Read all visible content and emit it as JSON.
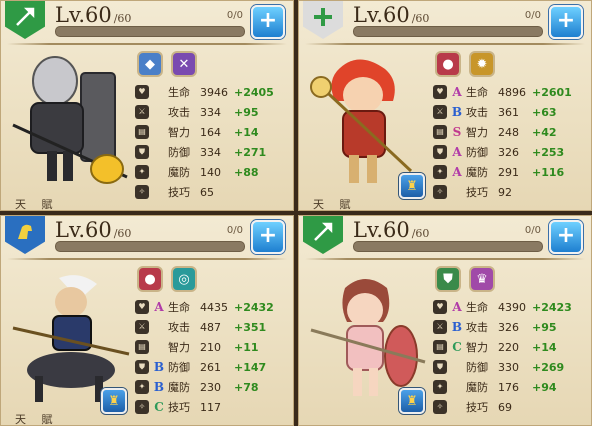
{
  "cards": [
    {
      "level_label": "Lv.60",
      "level_max": "/60",
      "exp_text": "0/0",
      "exp_fraction": 0,
      "class_icon": "spear-icon",
      "class_color": "#2f9a45",
      "plus_label": "+",
      "skills": [
        {
          "icon": "crystal-icon",
          "color": "#4a7fc8"
        },
        {
          "icon": "crossed-weapons-icon",
          "color": "#7a4ab0"
        }
      ],
      "talent_label": "",
      "stats": [
        {
          "icon": "heart-icon",
          "grade": "",
          "name": "生命",
          "value": "3946",
          "bonus": "+2405"
        },
        {
          "icon": "sword-icon",
          "grade": "",
          "name": "攻击",
          "value": "334",
          "bonus": "+95"
        },
        {
          "icon": "book-icon",
          "grade": "",
          "name": "智力",
          "value": "164",
          "bonus": "+14"
        },
        {
          "icon": "shield-icon",
          "grade": "",
          "name": "防御",
          "value": "334",
          "bonus": "+271"
        },
        {
          "icon": "magic-shield-icon",
          "grade": "",
          "name": "魔防",
          "value": "140",
          "bonus": "+88"
        },
        {
          "icon": "skill-icon",
          "grade": "",
          "name": "技巧",
          "value": "65",
          "bonus": ""
        }
      ]
    },
    {
      "level_label": "Lv.60",
      "level_max": "/60",
      "exp_text": "0/0",
      "exp_fraction": 0,
      "class_icon": "holy-cross-icon",
      "class_color": "#d8d8d8",
      "plus_label": "+",
      "skills": [
        {
          "icon": "bell-icon",
          "color": "#b83a4a"
        },
        {
          "icon": "sun-icon",
          "color": "#c8962a"
        }
      ],
      "talent_label": "天 賦",
      "stats": [
        {
          "icon": "heart-icon",
          "grade": "A",
          "name": "生命",
          "value": "4896",
          "bonus": "+2601"
        },
        {
          "icon": "sword-icon",
          "grade": "B",
          "name": "攻击",
          "value": "361",
          "bonus": "+63"
        },
        {
          "icon": "book-icon",
          "grade": "S",
          "name": "智力",
          "value": "248",
          "bonus": "+42"
        },
        {
          "icon": "shield-icon",
          "grade": "A",
          "name": "防御",
          "value": "326",
          "bonus": "+253"
        },
        {
          "icon": "magic-shield-icon",
          "grade": "A",
          "name": "魔防",
          "value": "291",
          "bonus": "+116"
        },
        {
          "icon": "skill-icon",
          "grade": "",
          "name": "技巧",
          "value": "92",
          "bonus": ""
        }
      ]
    },
    {
      "level_label": "Lv.60",
      "level_max": "/60",
      "exp_text": "0/0",
      "exp_fraction": 0,
      "class_icon": "horse-icon",
      "class_color": "#e0c040",
      "plus_label": "+",
      "skills": [
        {
          "icon": "bell-icon",
          "color": "#b83a4a"
        },
        {
          "icon": "swirl-icon",
          "color": "#2a9a9a"
        }
      ],
      "talent_label": "天 賦",
      "stats": [
        {
          "icon": "heart-icon",
          "grade": "A",
          "name": "生命",
          "value": "4435",
          "bonus": "+2432"
        },
        {
          "icon": "sword-icon",
          "grade": "",
          "name": "攻击",
          "value": "487",
          "bonus": "+351"
        },
        {
          "icon": "book-icon",
          "grade": "",
          "name": "智力",
          "value": "210",
          "bonus": "+11"
        },
        {
          "icon": "shield-icon",
          "grade": "B",
          "name": "防御",
          "value": "261",
          "bonus": "+147"
        },
        {
          "icon": "magic-shield-icon",
          "grade": "B",
          "name": "魔防",
          "value": "230",
          "bonus": "+78"
        },
        {
          "icon": "skill-icon",
          "grade": "C",
          "name": "技巧",
          "value": "117",
          "bonus": ""
        }
      ]
    },
    {
      "level_label": "Lv.60",
      "level_max": "/60",
      "exp_text": "0/0",
      "exp_fraction": 0,
      "class_icon": "spear-icon",
      "class_color": "#2f9a45",
      "plus_label": "+",
      "skills": [
        {
          "icon": "shield-emblem-icon",
          "color": "#3a8a4a"
        },
        {
          "icon": "crown-icon",
          "color": "#a04aa8"
        }
      ],
      "talent_label": "",
      "stats": [
        {
          "icon": "heart-icon",
          "grade": "A",
          "name": "生命",
          "value": "4390",
          "bonus": "+2423"
        },
        {
          "icon": "sword-icon",
          "grade": "B",
          "name": "攻击",
          "value": "326",
          "bonus": "+95"
        },
        {
          "icon": "book-icon",
          "grade": "C",
          "name": "智力",
          "value": "220",
          "bonus": "+14"
        },
        {
          "icon": "shield-icon",
          "grade": "",
          "name": "防御",
          "value": "330",
          "bonus": "+269"
        },
        {
          "icon": "magic-shield-icon",
          "grade": "",
          "name": "魔防",
          "value": "176",
          "bonus": "+94"
        },
        {
          "icon": "skill-icon",
          "grade": "",
          "name": "技巧",
          "value": "69",
          "bonus": ""
        }
      ]
    }
  ]
}
